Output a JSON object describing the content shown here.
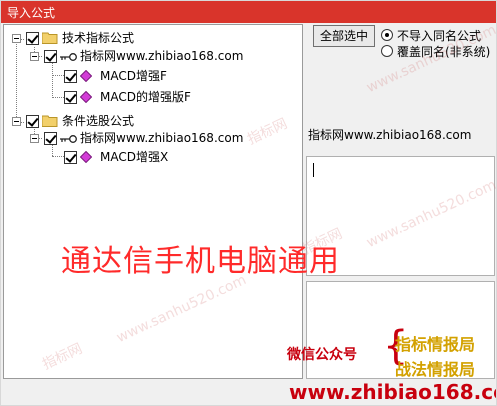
{
  "window": {
    "title": "导入公式"
  },
  "tree": {
    "categories": [
      {
        "label": "技术指标公式",
        "source": "指标网www.zhibiao168.com",
        "items": [
          "MACD增强F",
          "MACD的增强版F"
        ]
      },
      {
        "label": "条件选股公式",
        "source": "指标网www.zhibiao168.com",
        "items": [
          "MACD增强X"
        ]
      }
    ]
  },
  "right_panel": {
    "select_all_label": "全部选中",
    "radio_options": [
      {
        "label": "不导入同名公式",
        "selected": true
      },
      {
        "label": "覆盖同名(非系统)",
        "selected": false
      }
    ],
    "source_label": "指标网www.zhibiao168.com"
  },
  "overlays": {
    "headline": "通达信手机电脑通用",
    "wechat_label": "微信公众号",
    "brand_1": "指标情报局",
    "brand_2": "战法情报局",
    "site": "www.zhibiao168.com",
    "watermarks": [
      "指标网",
      "www.sanhu520.com",
      "指标网",
      "www.sanhu520.com",
      "指标网",
      "www.sanhu520.com"
    ]
  },
  "colors": {
    "title_bar": "#d9342b",
    "headline": "#ff2a2a",
    "promo_red": "#c8000e",
    "promo_gold": "#d3a100"
  }
}
